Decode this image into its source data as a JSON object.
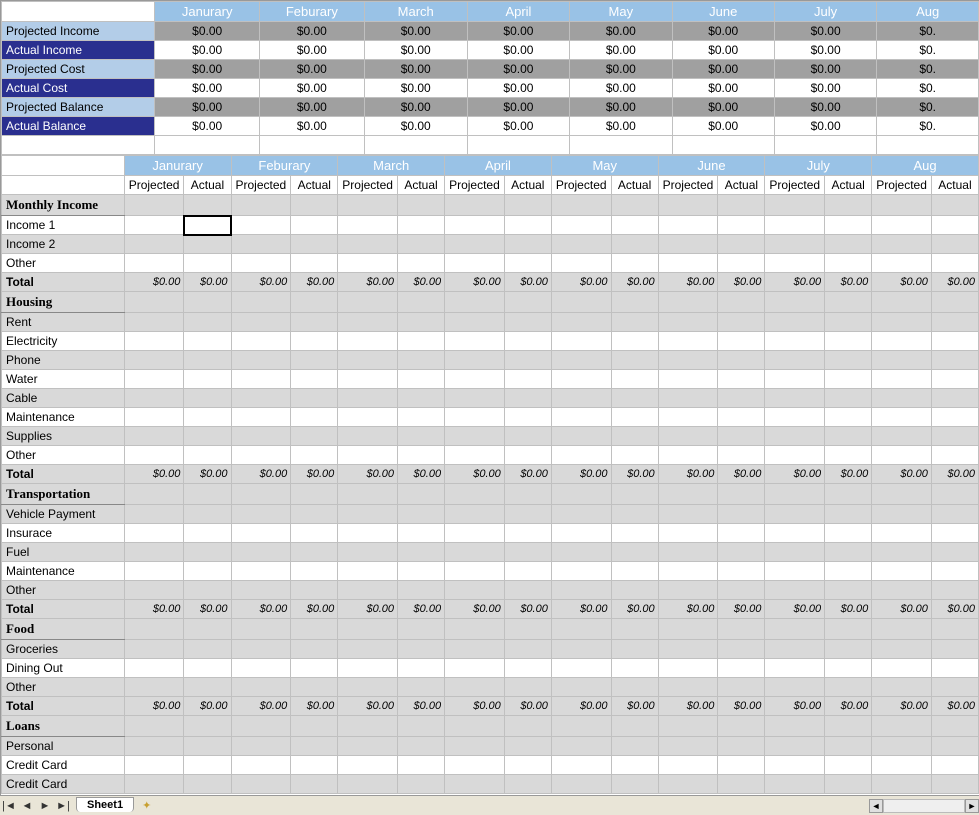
{
  "months": [
    "Janurary",
    "Feburary",
    "March",
    "April",
    "May",
    "June",
    "July",
    "Aug"
  ],
  "summary_rows": [
    {
      "label": "Projected Income",
      "style": "light",
      "vals": [
        "$0.00",
        "$0.00",
        "$0.00",
        "$0.00",
        "$0.00",
        "$0.00",
        "$0.00",
        "$0."
      ],
      "bg": "gray"
    },
    {
      "label": "Actual Income",
      "style": "dark",
      "vals": [
        "$0.00",
        "$0.00",
        "$0.00",
        "$0.00",
        "$0.00",
        "$0.00",
        "$0.00",
        "$0."
      ],
      "bg": "white"
    },
    {
      "label": "Projected Cost",
      "style": "light",
      "vals": [
        "$0.00",
        "$0.00",
        "$0.00",
        "$0.00",
        "$0.00",
        "$0.00",
        "$0.00",
        "$0."
      ],
      "bg": "gray"
    },
    {
      "label": "Actual Cost",
      "style": "dark",
      "vals": [
        "$0.00",
        "$0.00",
        "$0.00",
        "$0.00",
        "$0.00",
        "$0.00",
        "$0.00",
        "$0."
      ],
      "bg": "white"
    },
    {
      "label": "Projected Balance",
      "style": "light",
      "vals": [
        "$0.00",
        "$0.00",
        "$0.00",
        "$0.00",
        "$0.00",
        "$0.00",
        "$0.00",
        "$0."
      ],
      "bg": "gray"
    },
    {
      "label": "Actual Balance",
      "style": "dark",
      "vals": [
        "$0.00",
        "$0.00",
        "$0.00",
        "$0.00",
        "$0.00",
        "$0.00",
        "$0.00",
        "$0."
      ],
      "bg": "white"
    }
  ],
  "sublabels": {
    "projected": "Projected",
    "actual": "Actual"
  },
  "sections": [
    {
      "name": "Monthly Income",
      "shade_first": "white",
      "items": [
        "Income 1",
        "Income 2",
        "Other"
      ],
      "hasTotal": true
    },
    {
      "name": "Housing",
      "shade_first": "gray",
      "items": [
        "Rent",
        "Electricity",
        "Phone",
        "Water",
        "Cable",
        "Maintenance",
        "Supplies",
        "Other"
      ],
      "hasTotal": true
    },
    {
      "name": "Transportation",
      "shade_first": "gray",
      "items": [
        "Vehicle Payment",
        "Insurace",
        "Fuel",
        "Maintenance",
        "Other"
      ],
      "hasTotal": true
    },
    {
      "name": "Food",
      "shade_first": "gray",
      "items": [
        "Groceries",
        "Dining Out",
        "Other"
      ],
      "hasTotal": true
    },
    {
      "name": "Loans",
      "shade_first": "gray",
      "items": [
        "Personal",
        "Credit Card",
        "Credit Card"
      ],
      "hasTotal": false
    }
  ],
  "total_label": "Total",
  "total_val": "$0.00",
  "tabs": {
    "sheet": "Sheet1"
  }
}
